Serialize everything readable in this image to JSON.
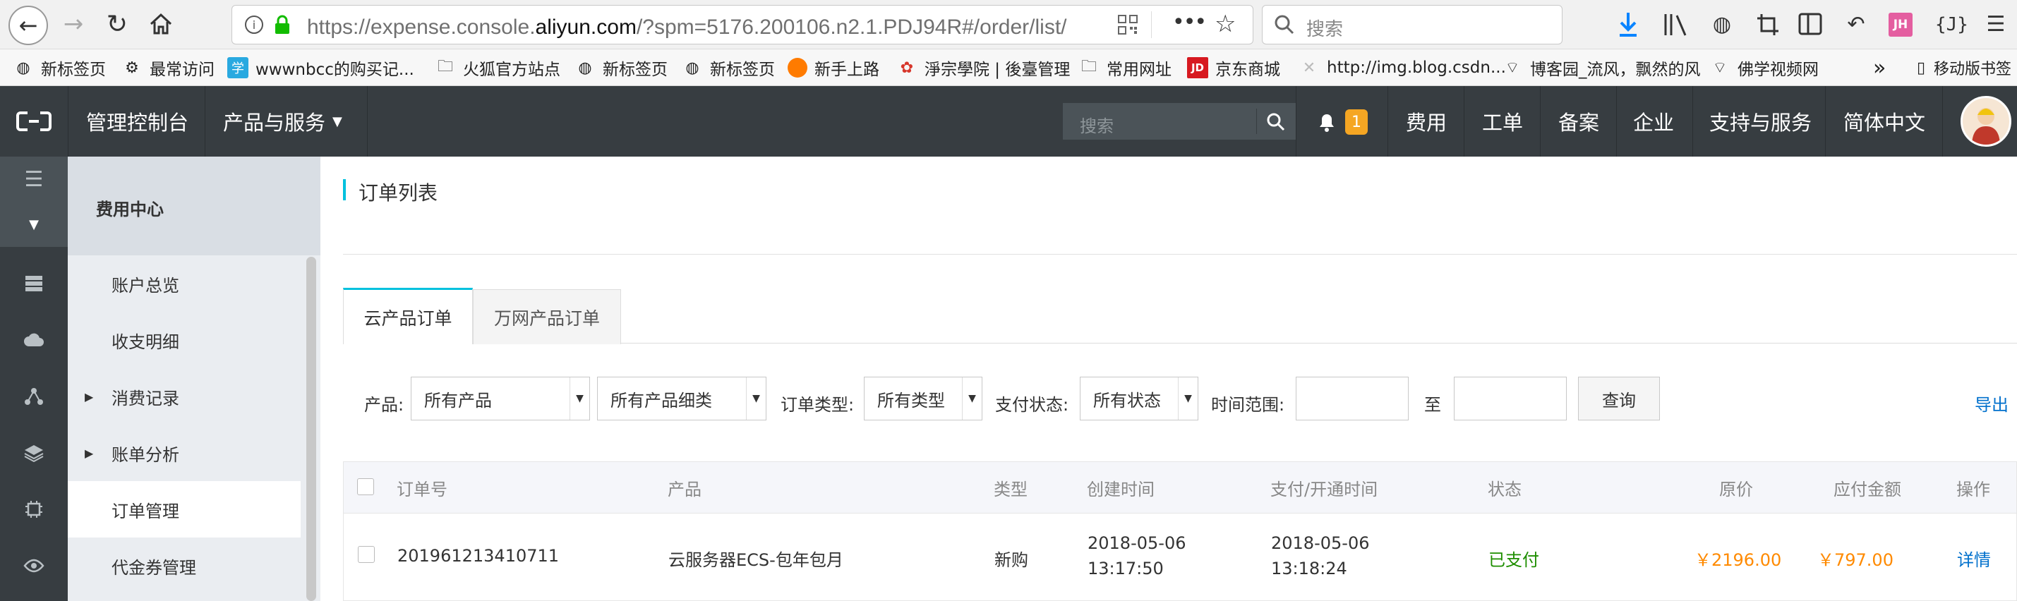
{
  "browser": {
    "url_prefix": "https://expense.console.",
    "url_host": "aliyun.com",
    "url_path": "/?spm=5176.200106.n2.1.PDJ94R#/order/list/",
    "search_placeholder": "搜索",
    "profile_initials": "JH",
    "devtools_label": "{J}",
    "bookmarks": [
      {
        "label": "新标签页",
        "icon": "globe-icon"
      },
      {
        "label": "最常访问",
        "icon": "gear-icon"
      },
      {
        "label": "wwwnbcc的购买记...",
        "icon": "xue-icon"
      },
      {
        "label": "火狐官方站点",
        "icon": "folder-icon"
      },
      {
        "label": "新标签页",
        "icon": "globe-icon"
      },
      {
        "label": "新标签页",
        "icon": "globe-icon"
      },
      {
        "label": "新手上路",
        "icon": "firefox-icon"
      },
      {
        "label": "淨宗學院 | 後臺管理",
        "icon": "lotus-icon"
      },
      {
        "label": "常用网址",
        "icon": "folder-icon"
      },
      {
        "label": "京东商城",
        "icon": "jd-icon"
      },
      {
        "label": "http://img.blog.csdn...",
        "icon": "broken-image-icon"
      },
      {
        "label": "博客园_流风，飘然的风",
        "icon": "rss-icon"
      },
      {
        "label": "佛学视频网",
        "icon": "rss-icon"
      }
    ],
    "mobile_bookmarks": "移动版书签"
  },
  "topnav": {
    "console": "管理控制台",
    "products": "产品与服务",
    "search_placeholder": "搜索",
    "notification_count": "1",
    "links": [
      "费用",
      "工单",
      "备案",
      "企业",
      "支持与服务",
      "简体中文"
    ]
  },
  "sidebar": {
    "title": "费用中心",
    "items": [
      {
        "label": "账户总览",
        "expandable": false
      },
      {
        "label": "收支明细",
        "expandable": false
      },
      {
        "label": "消费记录",
        "expandable": true
      },
      {
        "label": "账单分析",
        "expandable": true
      },
      {
        "label": "订单管理",
        "expandable": false
      },
      {
        "label": "代金券管理",
        "expandable": false
      }
    ],
    "active_item": "订单管理"
  },
  "page": {
    "title": "订单列表",
    "tabs": [
      "云产品订单",
      "万网产品订单"
    ],
    "active_tab": "云产品订单",
    "export_label": "导出"
  },
  "filters": {
    "product_label": "产品:",
    "product_value": "所有产品",
    "subcategory_value": "所有产品细类",
    "order_type_label": "订单类型:",
    "order_type_value": "所有类型",
    "pay_status_label": "支付状态:",
    "pay_status_value": "所有状态",
    "time_range_label": "时间范围:",
    "to_label": "至",
    "query_button": "查询"
  },
  "table": {
    "headers": [
      "订单号",
      "产品",
      "类型",
      "创建时间",
      "支付/开通时间",
      "状态",
      "原价",
      "应付金额",
      "操作"
    ],
    "rows": [
      {
        "order_no": "201961213410711",
        "product": "云服务器ECS-包年包月",
        "type": "新购",
        "created_date": "2018-05-06",
        "created_time": "13:17:50",
        "paid_date": "2018-05-06",
        "paid_time": "13:18:24",
        "status": "已支付",
        "original_price": "￥2196.00",
        "payable": "￥797.00",
        "action": "详情"
      }
    ]
  },
  "colors": {
    "accent": "#00c1de",
    "link": "#0070cc",
    "price": "#ff8a00",
    "paid": "#1e8e00",
    "nav_bg": "#373d41",
    "badge": "#f5a623"
  }
}
